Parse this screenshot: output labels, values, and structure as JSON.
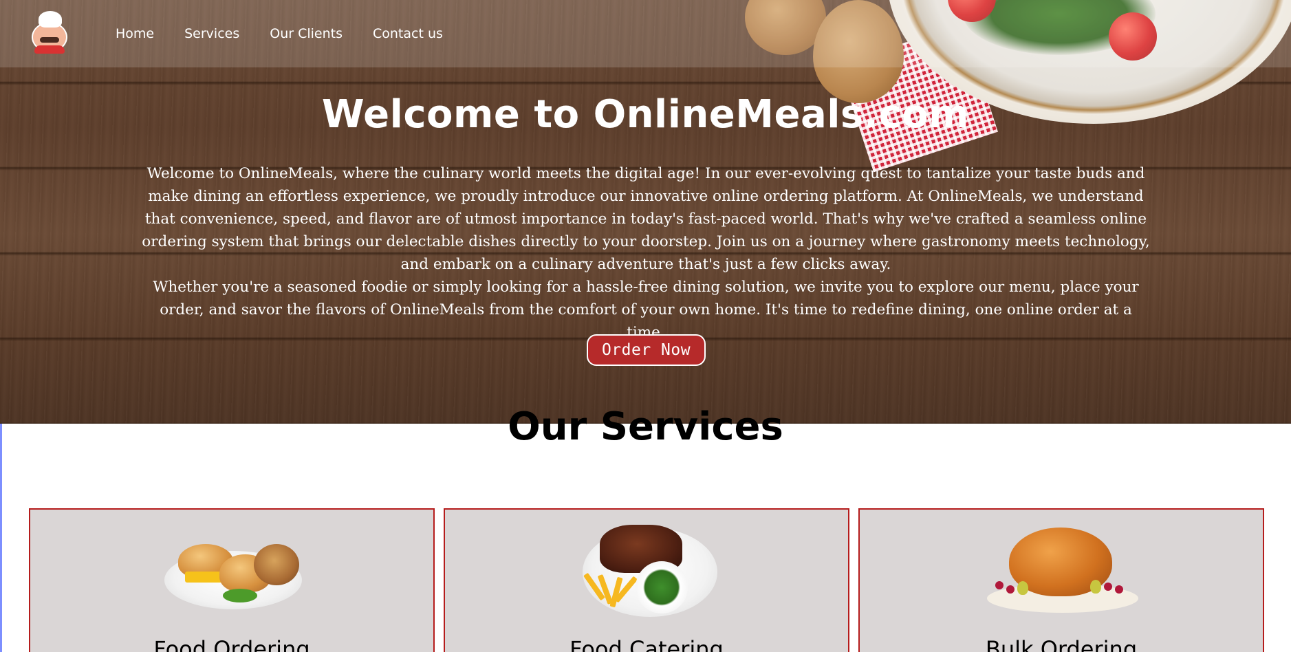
{
  "nav": {
    "logo_icon": "chef-logo-icon",
    "links": [
      "Home",
      "Services",
      "Our Clients",
      "Contact us"
    ]
  },
  "hero": {
    "title": "Welcome to OnlineMeals.com",
    "paragraph_1": "Welcome to OnlineMeals, where the culinary world meets the digital age! In our ever-evolving quest to tantalize your taste buds and make dining an effortless experience, we proudly introduce our innovative online ordering platform. At OnlineMeals, we understand that convenience, speed, and flavor are of utmost importance in today's fast-paced world. That's why we've crafted a seamless online ordering system that brings our delectable dishes directly to your doorstep. Join us on a journey where gastronomy meets technology, and embark on a culinary adventure that's just a few clicks away.",
    "paragraph_2": "Whether you're a seasoned foodie or simply looking for a hassle-free dining solution, we invite you to explore our menu, place your order, and savor the flavors of OnlineMeals from the comfort of your own home. It's time to redefine dining, one online order at a time.",
    "order_button": "Order Now"
  },
  "services": {
    "title": "Our Services",
    "cards": [
      {
        "title": "Food Ordering",
        "icon": "burger-plate-icon"
      },
      {
        "title": "Food Catering",
        "icon": "steak-plate-icon"
      },
      {
        "title": "Bulk Ordering",
        "icon": "roast-turkey-icon"
      }
    ]
  },
  "colors": {
    "accent": "#b62a2a",
    "card_bg": "#dad6d6",
    "card_border": "#b51c1c",
    "hero_wood": "#5e3f2c"
  }
}
